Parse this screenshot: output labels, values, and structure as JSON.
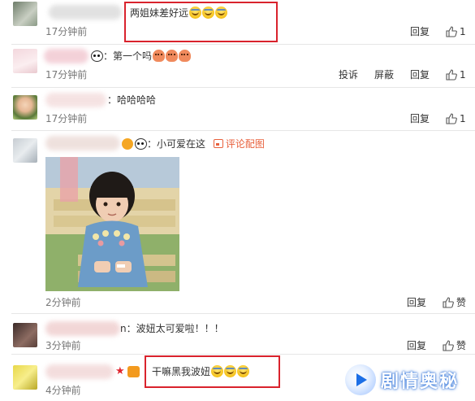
{
  "comments": [
    {
      "text": "两姐妹差好远",
      "time": "17分钟前",
      "actions": [
        "回复"
      ],
      "likes": "1"
    },
    {
      "text": "：第一个吗",
      "time": "17分钟前",
      "actions": [
        "投诉",
        "屏蔽",
        "回复"
      ],
      "likes": "1"
    },
    {
      "text": "：哈哈哈哈",
      "time": "17分钟前",
      "actions": [
        "回复"
      ],
      "likes": "1"
    },
    {
      "text": "：小可爱在这",
      "extra": "评论配图",
      "time": "2分钟前",
      "actions": [
        "回复"
      ],
      "likes": "赞"
    },
    {
      "text": "n：波妞太可爱啦！！！",
      "time": "3分钟前",
      "actions": [
        "回复"
      ],
      "likes": "赞"
    },
    {
      "text": "干嘛黑我波妞",
      "time": "4分钟前",
      "actions": [],
      "likes": ""
    }
  ],
  "watermark": {
    "text": "剧情奥秘"
  },
  "colors": {
    "highlight_box": "#d9232d",
    "link_orange": "#e8603c",
    "time_gray": "#777777"
  }
}
